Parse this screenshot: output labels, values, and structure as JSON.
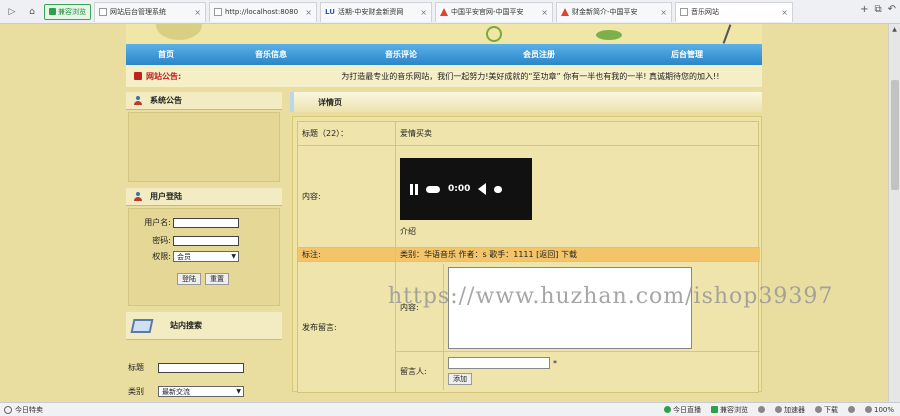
{
  "browser": {
    "mode_label": "兼容浏览",
    "tabs": [
      {
        "title": "网站后台管理系统",
        "icon": "page-icon"
      },
      {
        "title": "http://localhost:8080",
        "icon": "page-icon"
      },
      {
        "title": "活期-中安财金新资网",
        "icon": "lu-icon"
      },
      {
        "title": "中国平安官网-中国平安",
        "icon": "triangle-icon"
      },
      {
        "title": "财金新简介-中国平安",
        "icon": "triangle-icon"
      },
      {
        "title": "音乐网站",
        "icon": "page-icon",
        "active": true
      }
    ]
  },
  "site": {
    "nav": [
      "首页",
      "音乐信息",
      "音乐评论",
      "会员注册",
      "后台管理"
    ],
    "notice_label": "网站公告:",
    "notice_text": "为打造最专业的音乐网站，我们一起努力!美好成就的“至功章” 你有一半也有我的一半! 真诚期待您的加入!!"
  },
  "left": {
    "announcement_title": "系统公告",
    "login_title": "用户登陆",
    "username_label": "用户名:",
    "password_label": "密码:",
    "permission_label": "权限:",
    "permission_value": "会员",
    "login_button": "登陆",
    "reset_button": "重置",
    "search_title": "站内搜索",
    "search_title_label": "标题",
    "search_type_label": "类别",
    "search_type_value": "最新交流"
  },
  "detail": {
    "header": "详情页",
    "title_label": "标题（22）：",
    "title_value": "爱情买卖",
    "content_label": "内容:",
    "player_time": "0:00",
    "intro": "介绍",
    "remark_label": "标注:",
    "remark_value": "类别：华语音乐  作者：s  歌手：1111  [返回]  下载",
    "comment_label": "发布留言:",
    "comment_content_label": "内容:",
    "commenter_label": "留言人:",
    "required_mark": "*",
    "add_button": "添加"
  },
  "watermark": "https://www.huzhan.com/ishop39397",
  "status": {
    "left_label": "今日特卖",
    "items": [
      "今日直播",
      "兼容浏览",
      "",
      "加速器",
      "下载",
      "",
      "",
      "100%"
    ]
  }
}
